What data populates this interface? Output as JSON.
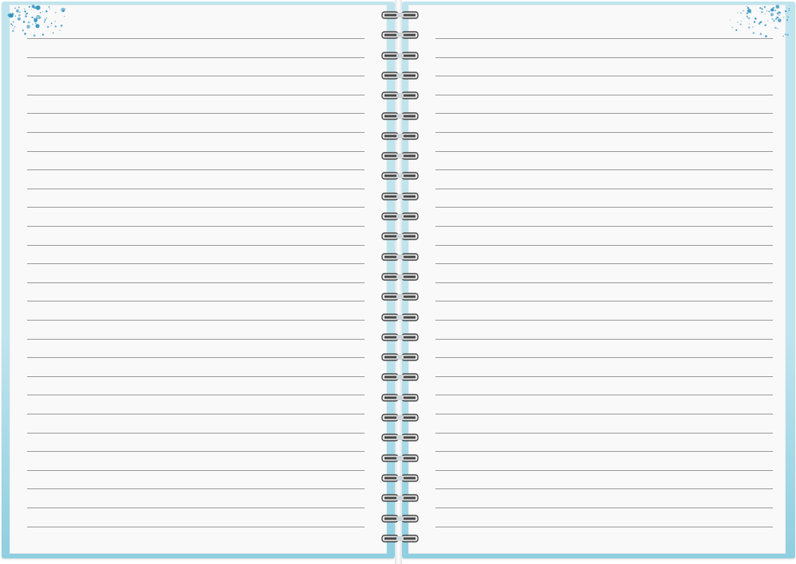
{
  "notebook": {
    "cover_color": "#bfe4ee",
    "cover_edge_color": "#8fcfe0",
    "page_color": "#f9f9f9",
    "rule_color": "#9a9a9a",
    "splash_color": "#2e8fc0",
    "left_page": {
      "ruled_lines": 27
    },
    "right_page": {
      "ruled_lines": 27
    },
    "spiral": {
      "ring_count": 27,
      "ring_color": "#444444"
    },
    "corner_decorations": [
      "splash-top-left",
      "splash-top-right"
    ]
  }
}
